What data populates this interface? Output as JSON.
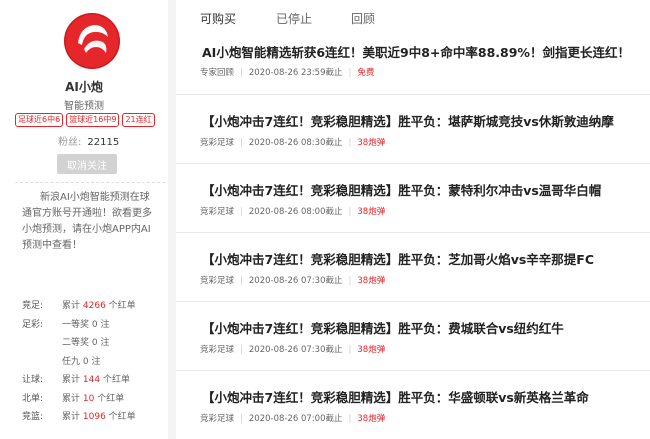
{
  "profile": {
    "name": "AI小炮",
    "subtitle": "智能预测",
    "badges": [
      "足球近6中6",
      "篮球近16中9",
      "21连红"
    ],
    "fans_label": "粉丝:",
    "fans_count": "22115",
    "follow_label": "取消关注",
    "description": "新浪AI小炮智能预测在球通官方账号开通啦！欲看更多小炮预测，请在小炮APP内AI预测中查看！",
    "brand_color": "#e5262b"
  },
  "stats": [
    {
      "label": "竞足:",
      "prefix": "累计",
      "value": "4266",
      "suffix": "个红单"
    },
    {
      "label": "足彩:",
      "prefix": "一等奖",
      "value": "0",
      "suffix": "注"
    },
    {
      "label": "",
      "prefix": "二等奖",
      "value": "0",
      "suffix": "注"
    },
    {
      "label": "",
      "prefix": "任九",
      "value": "0",
      "suffix": "注"
    },
    {
      "label": "让球:",
      "prefix": "累计",
      "value": "144",
      "suffix": "个红单"
    },
    {
      "label": "北单:",
      "prefix": "累计",
      "value": "10",
      "suffix": "个红单"
    },
    {
      "label": "竞篮:",
      "prefix": "累计",
      "value": "1096",
      "suffix": "个红单"
    }
  ],
  "tabs": [
    {
      "label": "可购买",
      "active": true
    },
    {
      "label": "已停止",
      "active": false
    },
    {
      "label": "回顾",
      "active": false
    }
  ],
  "articles": [
    {
      "title": "AI小炮智能精选斩获6连红！美职近9中8+命中率88.89%！剑指更长连红！",
      "category": "专家回顾",
      "time": "2020-08-26 23:59截止",
      "price": "免费"
    },
    {
      "title": "【小炮冲击7连红！竞彩稳胆精选】胜平负：堪萨斯城竞技vs休斯敦迪纳摩",
      "category": "竞彩足球",
      "time": "2020-08-26 08:30截止",
      "price": "38炮弹"
    },
    {
      "title": "【小炮冲击7连红！竞彩稳胆精选】胜平负：蒙特利尔冲击vs温哥华白帽",
      "category": "竞彩足球",
      "time": "2020-08-26 08:00截止",
      "price": "38炮弹"
    },
    {
      "title": "【小炮冲击7连红！竞彩稳胆精选】胜平负：芝加哥火焰vs辛辛那提FC",
      "category": "竞彩足球",
      "time": "2020-08-26 07:30截止",
      "price": "38炮弹"
    },
    {
      "title": "【小炮冲击7连红！竞彩稳胆精选】胜平负：费城联合vs纽约红牛",
      "category": "竞彩足球",
      "time": "2020-08-26 07:30截止",
      "price": "38炮弹"
    },
    {
      "title": "【小炮冲击7连红！竞彩稳胆精选】胜平负：华盛顿联vs新英格兰革命",
      "category": "竞彩足球",
      "time": "2020-08-26 07:00截止",
      "price": "38炮弹"
    }
  ]
}
